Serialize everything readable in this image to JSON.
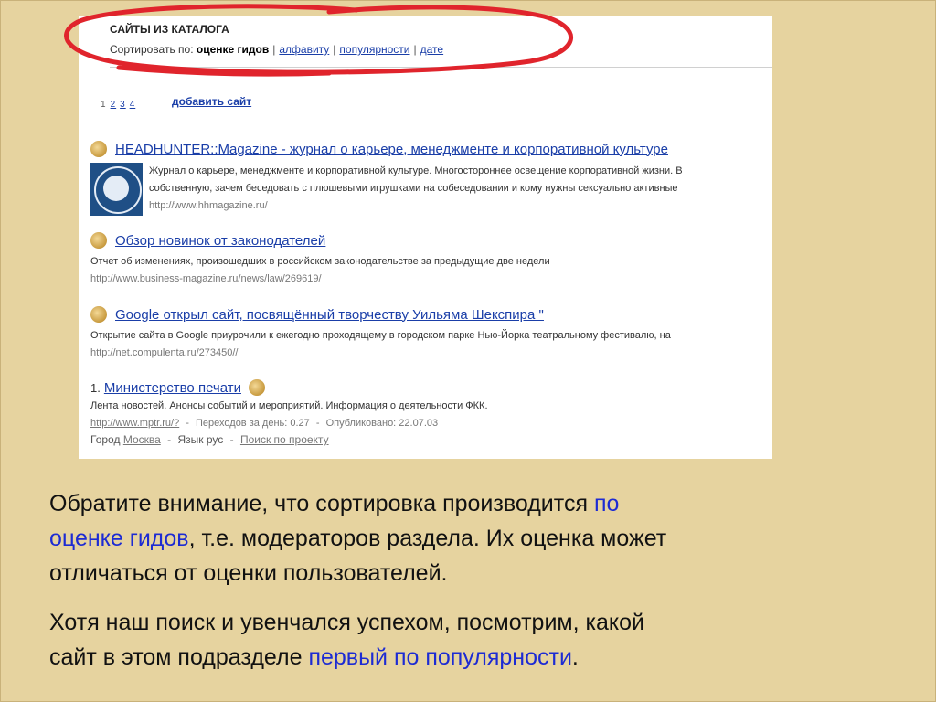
{
  "catalog": {
    "title": "САЙТЫ ИЗ КАТАЛОГА",
    "sort_label": "Сортировать по:",
    "sort_options": [
      "оценке гидов",
      "алфавиту",
      "популярности",
      "дате"
    ],
    "sort_separator": "|"
  },
  "pagination": {
    "current": "1",
    "pages": [
      "2",
      "3",
      "4"
    ]
  },
  "add_site_label": "добавить сайт",
  "results": [
    {
      "title": "HEADHUNTER::Magazine - журнал о карьере, менеджменте и корпоративной культуре",
      "desc1": "Журнал о карьере, менеджменте и корпоративной культуре. Многостороннее освещение корпоративной жизни. В",
      "desc2": "собственную, зачем беседовать с плюшевыми игрушками на собеседовании и кому нужны сексуально активные",
      "url": "http://www.hhmagazine.ru/"
    },
    {
      "title": "Обзор новинок от законодателей",
      "desc1": "Отчет об изменениях, произошедших в российском законодательстве за предыдущие две недели",
      "url": "http://www.business-magazine.ru/news/law/269619/"
    },
    {
      "title": "Google открыл сайт, посвящённый творчеству Уильяма Шекспира \"",
      "desc1": "Открытие сайта в Google приурочили к ежегодно проходящему в городском парке Нью-Йорка театральному фестивалю, на",
      "url": "http://net.compulenta.ru/273450//"
    }
  ],
  "ranked": {
    "number": "1.",
    "title": "Министерство печати",
    "desc": "Лента новостей. Анонсы событий и мероприятий. Информация о деятельности ФКК.",
    "url": "http://www.mptr.ru/?",
    "visits_label": "Переходов за день: 0.27",
    "published_label": "Опубликовано: 22.07.03",
    "dash": "-",
    "city_label": "Город",
    "city_value": "Москва",
    "lang_label": "Язык рус",
    "project_search": "Поиск по проекту"
  },
  "note": {
    "p1_part1": "Обратите внимание, что сортировка производится ",
    "p1_highlight_a": "по",
    "p1_highlight_b": "оценке гидов",
    "p1_part2": ", т.е. модераторов раздела. Их оценка может",
    "p1_line3": "отличаться от оценки пользователей.",
    "p2_line1": "Хотя наш поиск и увенчался успехом, посмотрим, какой",
    "p2_line2_part": "сайт в этом подразделе ",
    "p2_highlight": "первый по популярности",
    "p2_end": "."
  },
  "colors": {
    "background": "#e6d39f",
    "link": "#1a3ea8",
    "highlight_text": "#1d2bd3",
    "annotation_red": "#e0242c"
  }
}
